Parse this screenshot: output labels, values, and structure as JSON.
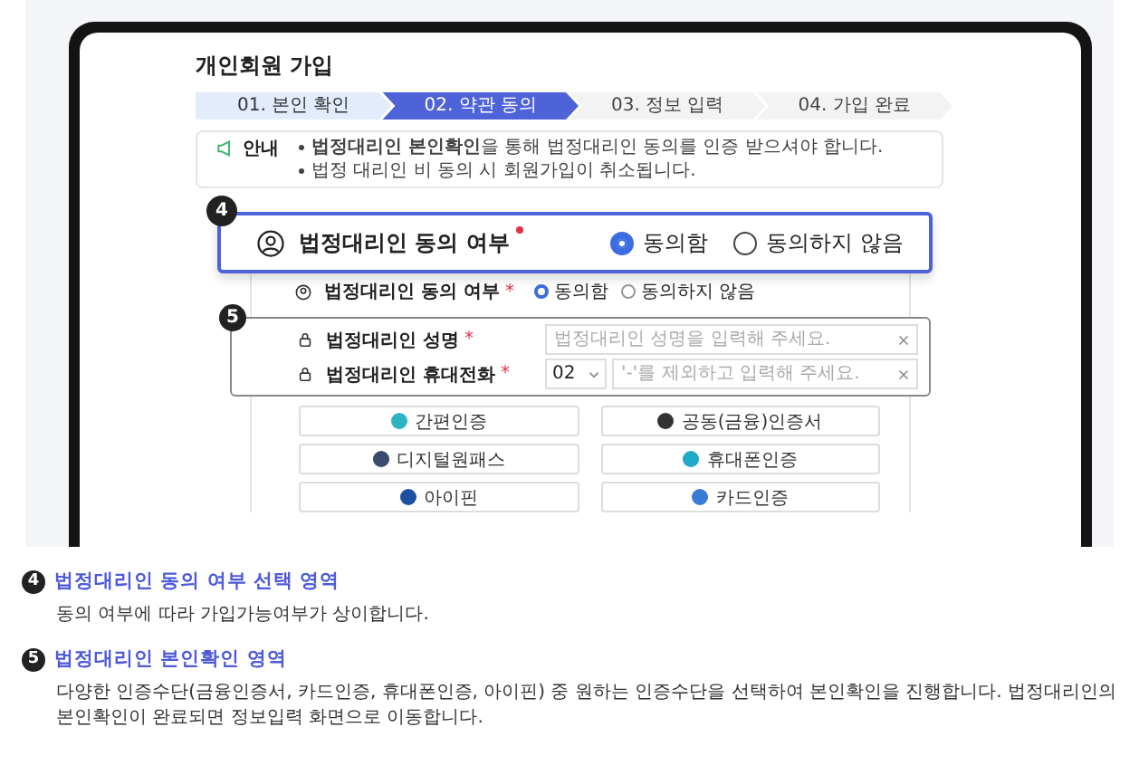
{
  "page_title": "개인회원 가입",
  "steps": [
    {
      "label": "01. 본인 확인",
      "done": true,
      "selected": false
    },
    {
      "label": "02. 약관 동의",
      "done": false,
      "selected": true
    },
    {
      "label": "03. 정보 입력",
      "done": false,
      "selected": false
    },
    {
      "label": "04. 가입 완료",
      "done": false,
      "selected": false
    }
  ],
  "notice": {
    "label": "안내",
    "lines": [
      "**법정대리인 본인확인**을 통해 법정대리인 동의를 인증 받으셔야 합니다.",
      "법정 대리인 비 동의 시 회원가입이 취소됩니다."
    ]
  },
  "callout": {
    "number": "4",
    "label": "법정대리인 동의 여부",
    "required": true,
    "options": [
      {
        "label": "동의함",
        "selected": true
      },
      {
        "label": "동의하지 않음",
        "selected": false
      }
    ]
  },
  "consent": {
    "label": "법정대리인 동의 여부",
    "required_mark": "*",
    "options": [
      {
        "label": "동의함",
        "selected": true
      },
      {
        "label": "동의하지 않음",
        "selected": false
      }
    ]
  },
  "fields_group": {
    "number": "5",
    "fields": [
      {
        "kind": "text",
        "label": "법정대리인 성명",
        "required_mark": "*",
        "placeholder": "법정대리인 성명을 입력해 주세요."
      },
      {
        "kind": "phone",
        "label": "법정대리인 휴대전화",
        "required_mark": "*",
        "prefix": "02",
        "placeholder": "'-'를 제외하고 입력해 주세요."
      }
    ]
  },
  "auth_buttons": [
    {
      "label": "간편인증",
      "color": "#2bb3c0"
    },
    {
      "label": "공동(금융)인증서",
      "color": "#333333"
    },
    {
      "label": "디지털원패스",
      "color": "#3a4a6b"
    },
    {
      "label": "휴대폰인증",
      "color": "#1fa8c9"
    },
    {
      "label": "아이핀",
      "color": "#1d4fa3"
    },
    {
      "label": "카드인증",
      "color": "#3a7bd5"
    }
  ],
  "legend": [
    {
      "number": "4",
      "title": "법정대리인 동의 여부 선택 영역",
      "description": "동의 여부에 따라 가입가능여부가 상이합니다."
    },
    {
      "number": "5",
      "title": "법정대리인 본인확인 영역",
      "description": "다양한 인증수단(금융인증서, 카드인증, 휴대폰인증, 아이핀) 중 원하는 인증수단을 선택하여 본인확인을 진행합니다. 법정대리인의 본인확인이 완료되면 정보입력 화면으로 이동합니다."
    }
  ]
}
